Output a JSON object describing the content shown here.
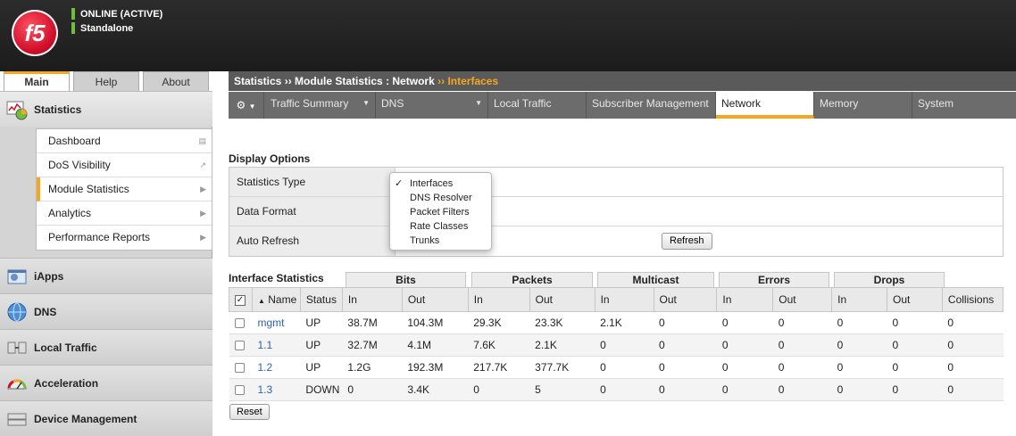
{
  "header": {
    "logo_text": "f5",
    "status_line1": "ONLINE (ACTIVE)",
    "status_line2": "Standalone"
  },
  "left_tabs": [
    "Main",
    "Help",
    "About"
  ],
  "nav": {
    "statistics": "Statistics",
    "sub_items": [
      "Dashboard",
      "DoS Visibility",
      "Module Statistics",
      "Analytics",
      "Performance Reports"
    ],
    "sections": [
      "iApps",
      "DNS",
      "Local Traffic",
      "Acceleration",
      "Device Management"
    ]
  },
  "breadcrumb": {
    "part1": "Statistics",
    "sep": "››",
    "part2": "Module Statistics : Network",
    "current": "Interfaces"
  },
  "tabs": [
    "Traffic Summary",
    "DNS",
    "Local Traffic",
    "Subscriber Management",
    "Network",
    "Memory",
    "System"
  ],
  "display_options": {
    "title": "Display Options",
    "stat_type_label": "Statistics Type",
    "data_format_label": "Data Format",
    "auto_refresh_label": "Auto Refresh",
    "refresh_button": "Refresh"
  },
  "dropdown": {
    "options": [
      "Interfaces",
      "DNS Resolver",
      "Packet Filters",
      "Rate Classes",
      "Trunks"
    ],
    "selected": "Interfaces"
  },
  "interface_stats": {
    "title": "Interface Statistics",
    "groups": [
      "Bits",
      "Packets",
      "Multicast",
      "Errors",
      "Drops"
    ],
    "columns": [
      "Name",
      "Status",
      "In",
      "Out",
      "In",
      "Out",
      "In",
      "Out",
      "In",
      "Out",
      "In",
      "Out",
      "Collisions"
    ],
    "rows": [
      {
        "name": "mgmt",
        "cells": [
          "UP",
          "38.7M",
          "104.3M",
          "29.3K",
          "23.3K",
          "2.1K",
          "0",
          "0",
          "0",
          "0",
          "0",
          "0"
        ]
      },
      {
        "name": "1.1",
        "cells": [
          "UP",
          "32.7M",
          "4.1M",
          "7.6K",
          "2.1K",
          "0",
          "0",
          "0",
          "0",
          "0",
          "0",
          "0"
        ]
      },
      {
        "name": "1.2",
        "cells": [
          "UP",
          "1.2G",
          "192.3M",
          "217.7K",
          "377.7K",
          "0",
          "0",
          "0",
          "0",
          "0",
          "0",
          "0"
        ]
      },
      {
        "name": "1.3",
        "cells": [
          "DOWN",
          "0",
          "3.4K",
          "0",
          "5",
          "0",
          "0",
          "0",
          "0",
          "0",
          "0",
          "0"
        ]
      }
    ],
    "reset_button": "Reset"
  },
  "colors": {
    "accent": "#f5a623",
    "header_bg": "#262626",
    "status_green": "#6fbf3a",
    "link_blue": "#2b62b8"
  }
}
